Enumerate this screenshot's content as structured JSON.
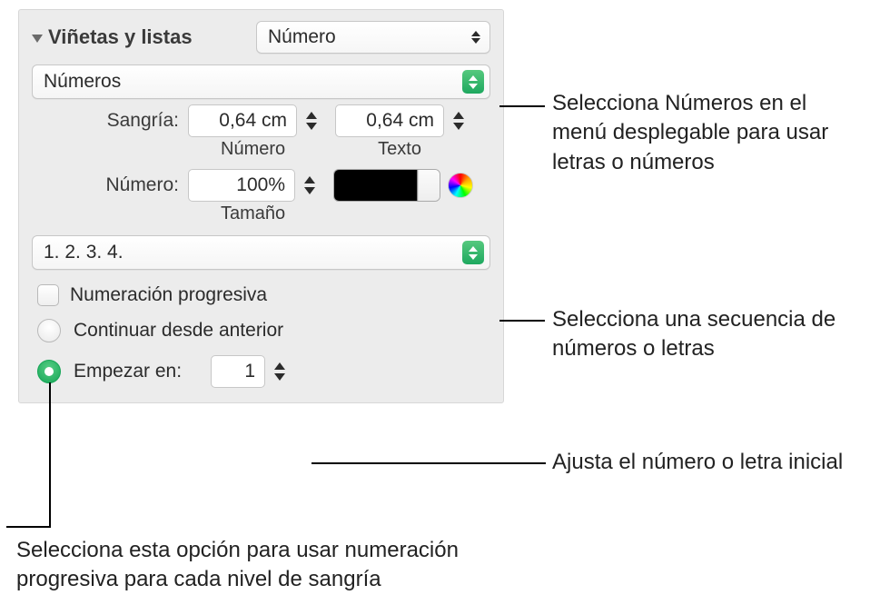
{
  "section": {
    "title": "Viñetas y listas",
    "type_popup_value": "Número"
  },
  "style_popup": {
    "value": "Números"
  },
  "indent": {
    "label": "Sangría:",
    "number_value": "0,64 cm",
    "text_value": "0,64 cm",
    "number_caption": "Número",
    "text_caption": "Texto"
  },
  "number_size": {
    "label": "Número:",
    "value": "100%",
    "caption": "Tamaño"
  },
  "sequence_popup": {
    "value": "1. 2. 3. 4."
  },
  "checkbox": {
    "label": "Numeración progresiva"
  },
  "radio": {
    "continue_label": "Continuar desde anterior",
    "start_label": "Empezar en:",
    "start_value": "1",
    "selected": "start"
  },
  "callouts": {
    "style": "Selecciona Números en el menú desplegable para usar letras o números",
    "sequence": "Selecciona una secuencia de números o letras",
    "start": "Ajusta el número o letra inicial",
    "progressive": "Selecciona esta opción para usar numeración progresiva para cada nivel de sangría"
  }
}
